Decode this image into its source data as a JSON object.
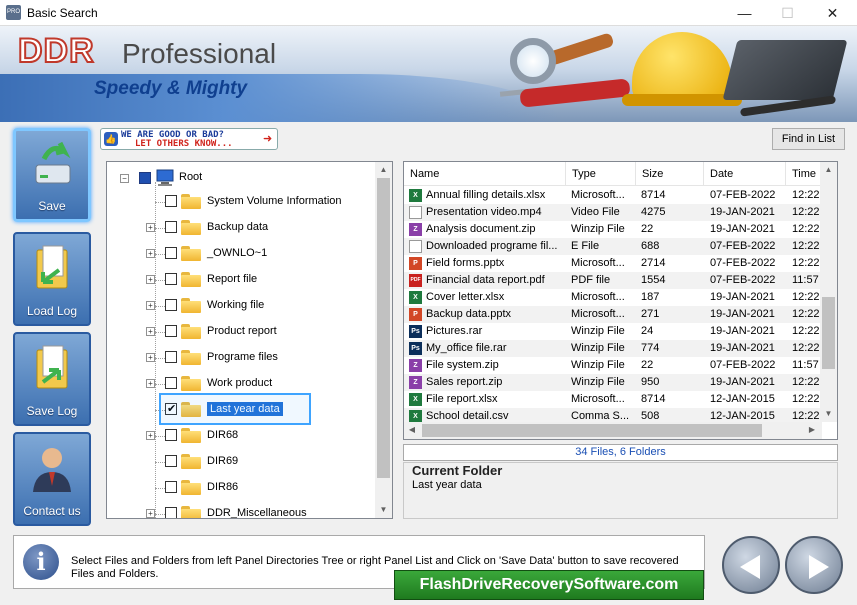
{
  "window": {
    "title": "Basic Search",
    "icon_text": "PRO",
    "min": "—",
    "max": "☐",
    "close": "✕"
  },
  "banner": {
    "brand_main": "DDR",
    "brand_sub": "Professional",
    "tagline": "Speedy & Mighty"
  },
  "nav": [
    {
      "label": "Save",
      "selected": true
    },
    {
      "label": "Load Log",
      "selected": false
    },
    {
      "label": "Save Log",
      "selected": false
    },
    {
      "label": "Contact us",
      "selected": false
    }
  ],
  "slogan": {
    "line1": "WE ARE GOOD OR BAD?",
    "line2": "LET OTHERS KNOW..."
  },
  "find_button": "Find in List",
  "tree": {
    "root": "Root",
    "items": [
      {
        "label": "System Volume Information",
        "expandable": false,
        "checked": false
      },
      {
        "label": "Backup data",
        "expandable": true,
        "checked": false
      },
      {
        "label": "_OWNLO~1",
        "expandable": true,
        "checked": false
      },
      {
        "label": "Report file",
        "expandable": true,
        "checked": false
      },
      {
        "label": "Working file",
        "expandable": true,
        "checked": false
      },
      {
        "label": "Product report",
        "expandable": true,
        "checked": false
      },
      {
        "label": "Programe files",
        "expandable": true,
        "checked": false
      },
      {
        "label": "Work product",
        "expandable": true,
        "checked": false
      },
      {
        "label": "Last year data",
        "expandable": false,
        "checked": true,
        "selected": true
      },
      {
        "label": "DIR68",
        "expandable": true,
        "checked": false
      },
      {
        "label": "DIR69",
        "expandable": false,
        "checked": false
      },
      {
        "label": "DIR86",
        "expandable": false,
        "checked": false
      },
      {
        "label": "DDR_Miscellaneous",
        "expandable": true,
        "checked": false
      }
    ]
  },
  "list": {
    "columns": [
      "Name",
      "Type",
      "Size",
      "Date",
      "Time"
    ],
    "rows": [
      {
        "icon": "xls",
        "name": "Annual filling details.xlsx",
        "type": "Microsoft...",
        "size": "8714",
        "date": "07-FEB-2022",
        "time": "12:22"
      },
      {
        "icon": "blank",
        "name": "Presentation video.mp4",
        "type": "Video File",
        "size": "4275",
        "date": "19-JAN-2021",
        "time": "12:22"
      },
      {
        "icon": "zip",
        "name": "Analysis document.zip",
        "type": "Winzip File",
        "size": "22",
        "date": "19-JAN-2021",
        "time": "12:22"
      },
      {
        "icon": "blank",
        "name": "Downloaded programe fil...",
        "type": "E File",
        "size": "688",
        "date": "07-FEB-2022",
        "time": "12:22"
      },
      {
        "icon": "ppt",
        "name": "Field forms.pptx",
        "type": "Microsoft...",
        "size": "2714",
        "date": "07-FEB-2022",
        "time": "12:22"
      },
      {
        "icon": "pdf",
        "name": "Financial data report.pdf",
        "type": "PDF file",
        "size": "1554",
        "date": "07-FEB-2022",
        "time": "11:57"
      },
      {
        "icon": "xls",
        "name": "Cover letter.xlsx",
        "type": "Microsoft...",
        "size": "187",
        "date": "19-JAN-2021",
        "time": "12:22"
      },
      {
        "icon": "ppt",
        "name": "Backup data.pptx",
        "type": "Microsoft...",
        "size": "271",
        "date": "19-JAN-2021",
        "time": "12:22"
      },
      {
        "icon": "ps",
        "name": "Pictures.rar",
        "type": "Winzip File",
        "size": "24",
        "date": "19-JAN-2021",
        "time": "12:22"
      },
      {
        "icon": "ps",
        "name": "My_office file.rar",
        "type": "Winzip File",
        "size": "774",
        "date": "19-JAN-2021",
        "time": "12:22"
      },
      {
        "icon": "zip",
        "name": "File system.zip",
        "type": "Winzip File",
        "size": "22",
        "date": "07-FEB-2022",
        "time": "11:57"
      },
      {
        "icon": "zip",
        "name": "Sales report.zip",
        "type": "Winzip File",
        "size": "950",
        "date": "19-JAN-2021",
        "time": "12:22"
      },
      {
        "icon": "xls",
        "name": "File report.xlsx",
        "type": "Microsoft...",
        "size": "8714",
        "date": "12-JAN-2015",
        "time": "12:22"
      },
      {
        "icon": "xls",
        "name": "School detail.csv",
        "type": "Comma S...",
        "size": "508",
        "date": "12-JAN-2015",
        "time": "12:22"
      }
    ]
  },
  "count": "34 Files, 6 Folders",
  "current_folder": {
    "title": "Current Folder",
    "value": "Last year data"
  },
  "bottom": {
    "info": "i",
    "text": "Select Files and Folders from left Panel Directories Tree or right Panel List and Click on 'Save Data' button to save recovered Files and Folders.",
    "promo": "FlashDriveRecoverySoftware.com"
  },
  "icon_colors": {
    "xls": "#1f7a3e",
    "zip": "#8a3fa8",
    "ppt": "#d24726",
    "pdf": "#c9211e",
    "ps": "#0b2e5a",
    "blank": "#ffffff"
  }
}
